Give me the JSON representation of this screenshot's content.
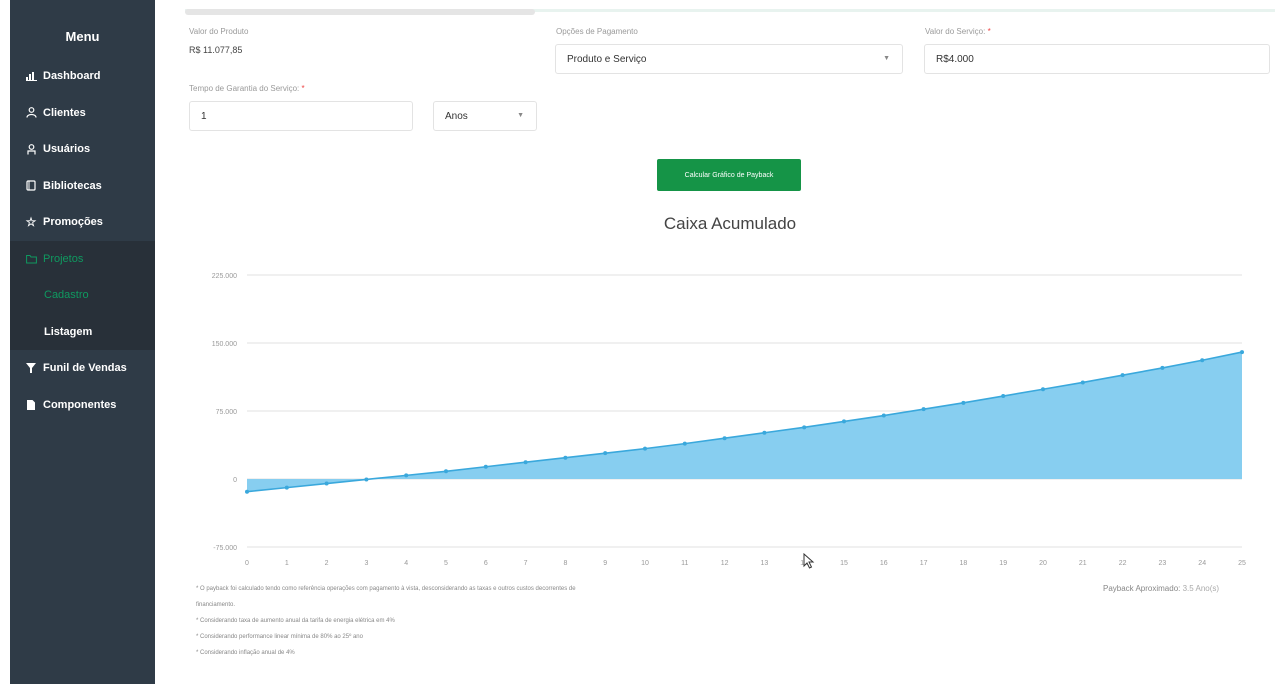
{
  "sidebar": {
    "title": "Menu",
    "items": [
      {
        "label": "Dashboard",
        "icon": "bar-chart-icon"
      },
      {
        "label": "Clientes",
        "icon": "users-icon"
      },
      {
        "label": "Usuários",
        "icon": "user-icon"
      },
      {
        "label": "Bibliotecas",
        "icon": "book-icon"
      },
      {
        "label": "Promoções",
        "icon": "star-icon"
      },
      {
        "label": "Projetos",
        "icon": "folder-icon"
      }
    ],
    "sub_items": [
      {
        "label": "Cadastro"
      },
      {
        "label": "Listagem"
      }
    ],
    "items_after": [
      {
        "label": "Funil de Vendas",
        "icon": "filter-icon"
      },
      {
        "label": "Componentes",
        "icon": "file-icon"
      }
    ],
    "accent": "#0f9960",
    "background": "#2f3b47"
  },
  "form": {
    "produto": {
      "label": "Valor do Produto",
      "value": "R$ 11.077,85"
    },
    "pagamento": {
      "label": "Opções de Pagamento",
      "value": "Produto e Serviço"
    },
    "servico": {
      "label": "Valor do Serviço:",
      "required": "*",
      "value": "R$4.000"
    },
    "garantia": {
      "label": "Tempo de Garantia do Serviço:",
      "required": "*",
      "value": "1",
      "unit": "Anos"
    }
  },
  "button": {
    "label": "Calcular Gráfico de Payback",
    "color": "#159447"
  },
  "chart_data": {
    "type": "area",
    "title": "Caixa Acumulado",
    "x": [
      0,
      1,
      2,
      3,
      4,
      5,
      6,
      7,
      8,
      9,
      10,
      11,
      12,
      13,
      14,
      15,
      16,
      17,
      18,
      19,
      20,
      21,
      22,
      23,
      24,
      25
    ],
    "values": [
      -14000,
      -9500,
      -5000,
      -500,
      4000,
      8500,
      13500,
      18500,
      23500,
      28500,
      33500,
      39000,
      45000,
      51000,
      57000,
      63500,
      70000,
      77000,
      84000,
      91500,
      99000,
      106500,
      114500,
      122500,
      131000,
      140000
    ],
    "yticks": [
      -75000,
      0,
      75000,
      150000,
      225000
    ],
    "ytick_labels": [
      "-75.000",
      "0",
      "75.000",
      "150.000",
      "225.000"
    ],
    "ylim": [
      -75000,
      225000
    ],
    "xlim": [
      0,
      25
    ],
    "fill_color": "#87cef0",
    "line_color": "#3aa8dc",
    "grid": true
  },
  "notes": [
    "* O payback foi calculado tendo como referência operações com pagamento à vista, desconsiderando as taxas e outros custos decorrentes de",
    "financiamento.",
    "* Considerando taxa de aumento anual da tarifa de energia elétrica em 4%",
    "* Considerando performance linear mínima de 80% ao 25º ano",
    "* Considerando inflação anual de 4%"
  ],
  "payback": {
    "label": "Payback Aproximado:",
    "value": "3.5 Ano(s)"
  }
}
